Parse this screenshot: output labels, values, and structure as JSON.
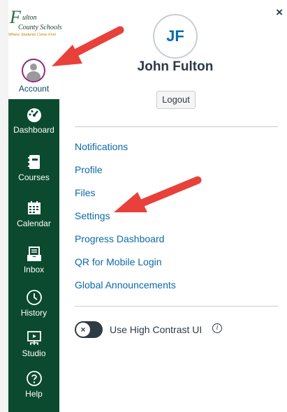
{
  "logo": {
    "line_f": "F",
    "line1": "ulton",
    "line2": "County Schools",
    "tagline": "Where Students Come First"
  },
  "nav": {
    "account": "Account",
    "items": [
      {
        "label": "Dashboard",
        "icon": "dashboard-icon"
      },
      {
        "label": "Courses",
        "icon": "courses-icon"
      },
      {
        "label": "Calendar",
        "icon": "calendar-icon"
      },
      {
        "label": "Inbox",
        "icon": "inbox-icon"
      },
      {
        "label": "History",
        "icon": "history-icon"
      },
      {
        "label": "Studio",
        "icon": "studio-icon"
      },
      {
        "label": "Help",
        "icon": "help-icon"
      }
    ]
  },
  "tray": {
    "close": "×",
    "initials": "JF",
    "name": "John Fulton",
    "logout": "Logout",
    "menu": [
      "Notifications",
      "Profile",
      "Files",
      "Settings",
      "Progress Dashboard",
      "QR for Mobile Login",
      "Global Announcements"
    ],
    "toggle_symbol": "×",
    "high_contrast_label": "Use High Contrast UI",
    "info_symbol": "i"
  },
  "colors": {
    "nav_bg": "#0b4a2f",
    "link": "#0b6aa8",
    "arrow": "#e8413b",
    "avatar_ring": "#8a2a7c"
  }
}
